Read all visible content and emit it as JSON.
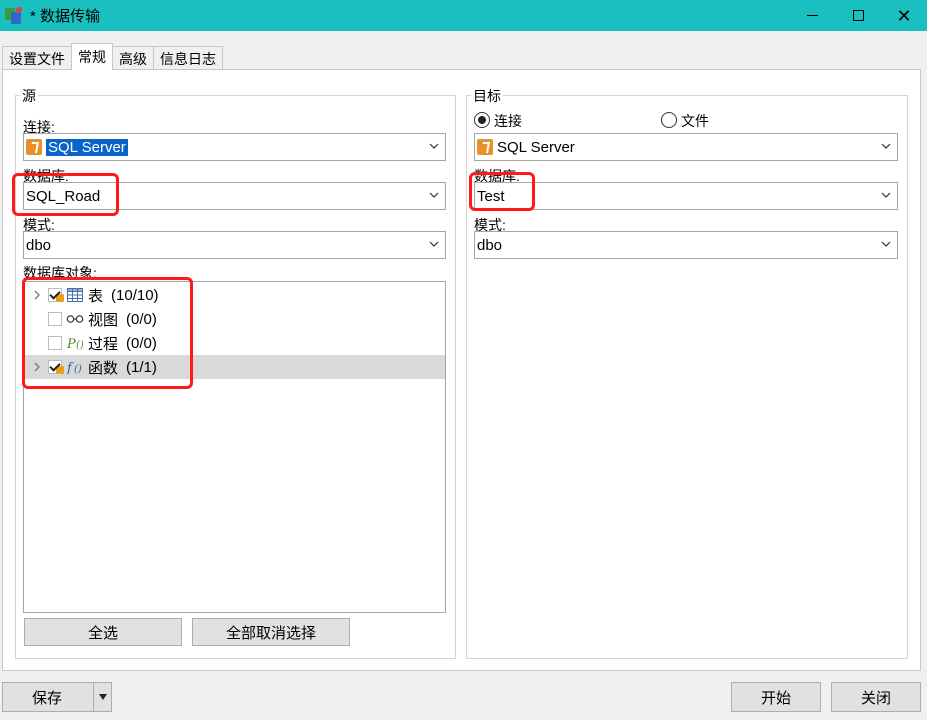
{
  "window": {
    "title": "* 数据传输"
  },
  "tabs": [
    {
      "label": "设置文件"
    },
    {
      "label": "常规"
    },
    {
      "label": "高级"
    },
    {
      "label": "信息日志"
    }
  ],
  "source": {
    "legend": "源",
    "connection_label": "连接:",
    "connection_value": "SQL Server",
    "database_label": "数据库:",
    "database_value": "SQL_Road",
    "schema_label": "模式:",
    "schema_value": "dbo",
    "objects_label": "数据库对象:",
    "objects": [
      {
        "label": "表",
        "count": "(10/10)",
        "checked": true,
        "expandable": true,
        "icon": "table-icon"
      },
      {
        "label": "视图",
        "count": "(0/0)",
        "checked": false,
        "expandable": false,
        "icon": "view-glasses-icon"
      },
      {
        "label": "过程",
        "count": "(0/0)",
        "checked": false,
        "expandable": false,
        "icon": "procedure-icon"
      },
      {
        "label": "函数",
        "count": "(1/1)",
        "checked": true,
        "expandable": true,
        "icon": "function-icon"
      }
    ],
    "select_all": "全选",
    "deselect_all": "全部取消选择"
  },
  "target": {
    "legend": "目标",
    "radio_connection": "连接",
    "radio_file": "文件",
    "connection_value": "SQL Server",
    "database_label": "数据库:",
    "database_value": "Test",
    "schema_label": "模式:",
    "schema_value": "dbo"
  },
  "footer": {
    "save": "保存",
    "start": "开始",
    "close": "关闭"
  },
  "colors": {
    "titlebar": "#1abfbf",
    "highlight_box": "#ff1a1a",
    "selection": "#0a64c8"
  }
}
